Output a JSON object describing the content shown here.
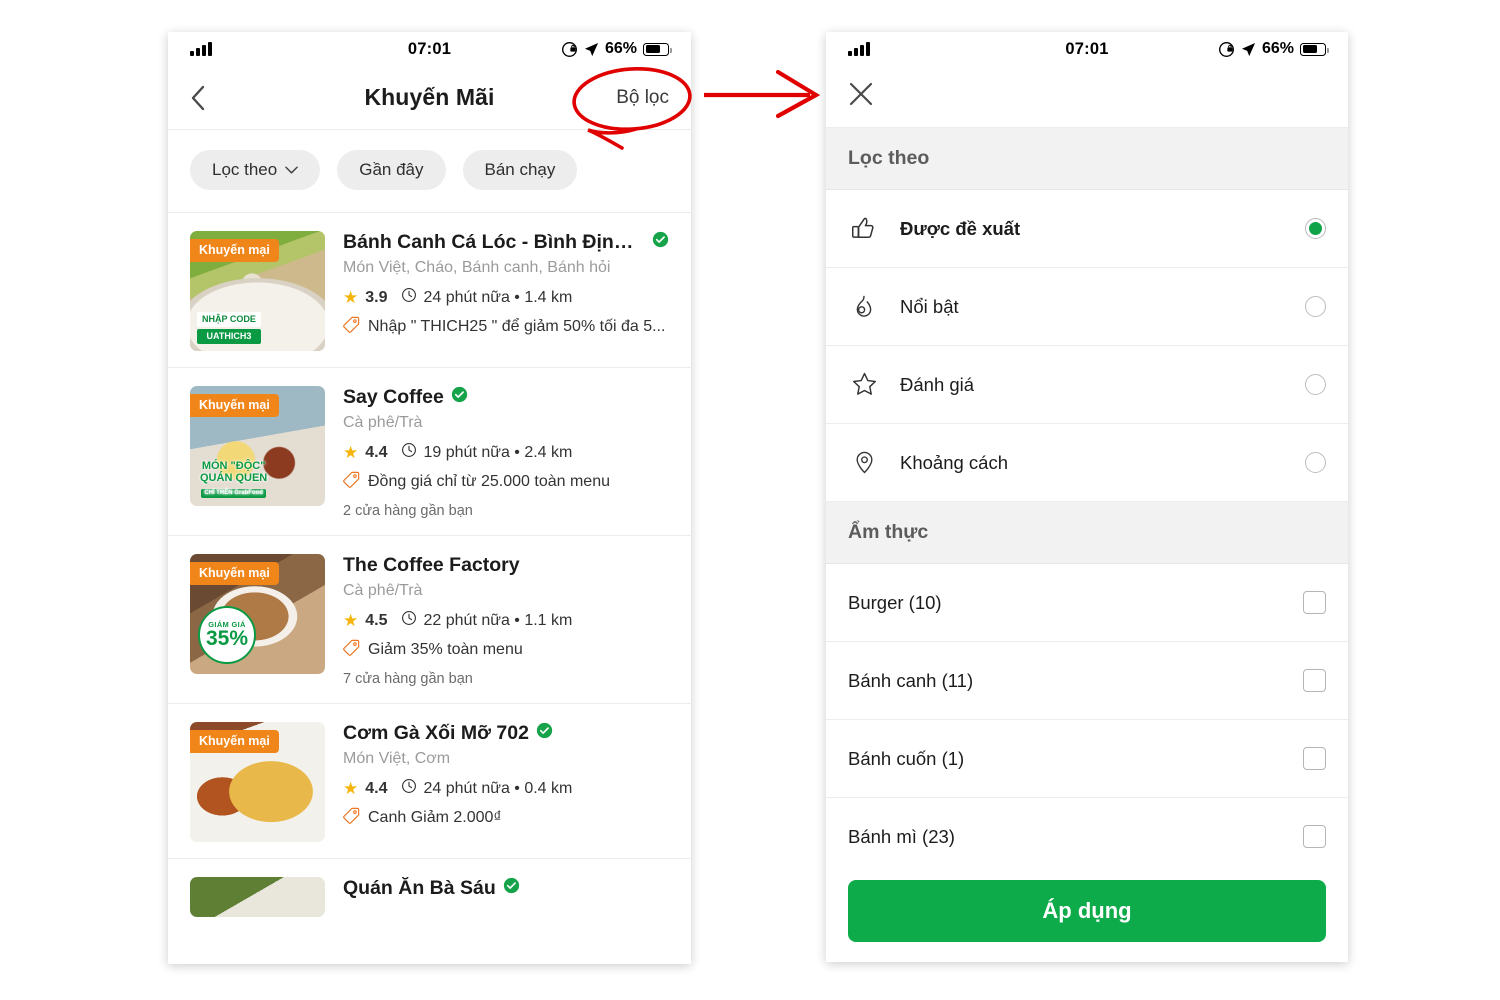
{
  "status_bar": {
    "time": "07:01",
    "battery_percent": "66%",
    "signal_icon": "cellular-signal-icon",
    "lock_rotation_icon": "rotation-lock-icon",
    "location_icon": "location-arrow-icon",
    "battery_icon": "battery-icon"
  },
  "colors": {
    "brand_green": "#0eab4b",
    "promo_orange": "#f08519",
    "star_yellow": "#f5b50a",
    "annotation_red": "#e00000",
    "chip_grey": "#ededed",
    "section_grey": "#f2f2f2"
  },
  "left_screen": {
    "nav": {
      "back_icon": "chevron-left-icon",
      "title": "Khuyến Mãi",
      "action_label": "Bộ lọc"
    },
    "chips": [
      {
        "label": "Lọc theo",
        "has_caret": true
      },
      {
        "label": "Gần đây",
        "has_caret": false
      },
      {
        "label": "Bán chạy",
        "has_caret": false
      }
    ],
    "restaurants": [
      {
        "badge": "Khuyến mại",
        "name": "Bánh Canh Cá Lóc - Bình Định Q...",
        "verified": true,
        "cuisine": "Món Việt, Cháo, Bánh canh, Bánh hỏi",
        "rating": "3.9",
        "eta": "24 phút nữa • 1.4 km",
        "promo": "Nhập \" THICH25 \" để giảm 50% tối đa 5...",
        "stores": "",
        "thumb_overlay_line1": "NHẬP CODE",
        "thumb_overlay_line2": "UATHICH3"
      },
      {
        "badge": "Khuyến mại",
        "name": "Say Coffee",
        "verified": true,
        "cuisine": "Cà phê/Trà",
        "rating": "4.4",
        "eta": "19 phút nữa • 2.4 km",
        "promo": "Đồng giá chỉ từ 25.000 toàn menu",
        "stores": "2 cửa hàng gần bạn",
        "thumb_overlay_line1": "MÓN \"ĐỘC\"",
        "thumb_overlay_line2": "QUÁN QUEN",
        "thumb_overlay_line3": "CHỈ TRÊN GrabFood"
      },
      {
        "badge": "Khuyến mại",
        "name": "The Coffee Factory",
        "verified": false,
        "cuisine": "Cà phê/Trà",
        "rating": "4.5",
        "eta": "22 phút nữa • 1.1 km",
        "promo": "Giảm 35% toàn menu",
        "stores": "7 cửa hàng gần bạn",
        "thumb_overlay_line1": "GIẢM GIÁ",
        "thumb_overlay_line2": "35%"
      },
      {
        "badge": "Khuyến mại",
        "name": "Cơm Gà Xối Mỡ 702",
        "verified": true,
        "cuisine": "Món Việt, Cơm",
        "rating": "4.4",
        "eta": "24 phút nữa • 0.4 km",
        "promo": "Canh  Giảm 2.000₫",
        "stores": ""
      },
      {
        "badge": "",
        "name": "Quán Ăn Bà Sáu",
        "verified": true,
        "cuisine": "",
        "rating": "",
        "eta": "",
        "promo": "",
        "stores": ""
      }
    ]
  },
  "right_screen": {
    "close_icon": "close-icon",
    "sections": [
      {
        "title": "Lọc theo",
        "type": "radio",
        "options": [
          {
            "label": "Được đề xuất",
            "icon": "thumbs-up-icon",
            "selected": true
          },
          {
            "label": "Nổi bật",
            "icon": "flame-icon",
            "selected": false
          },
          {
            "label": "Đánh giá",
            "icon": "star-outline-icon",
            "selected": false
          },
          {
            "label": "Khoảng cách",
            "icon": "map-pin-icon",
            "selected": false
          }
        ]
      },
      {
        "title": "Ẩm thực",
        "type": "checkbox",
        "options": [
          {
            "label": "Burger (10)",
            "checked": false
          },
          {
            "label": "Bánh canh (11)",
            "checked": false
          },
          {
            "label": "Bánh cuốn (1)",
            "checked": false
          },
          {
            "label": "Bánh mì (23)",
            "checked": false
          }
        ]
      }
    ],
    "apply_label": "Áp dụng"
  },
  "annotations": {
    "circle_target": "Bộ lọc",
    "arrow_direction": "right"
  }
}
